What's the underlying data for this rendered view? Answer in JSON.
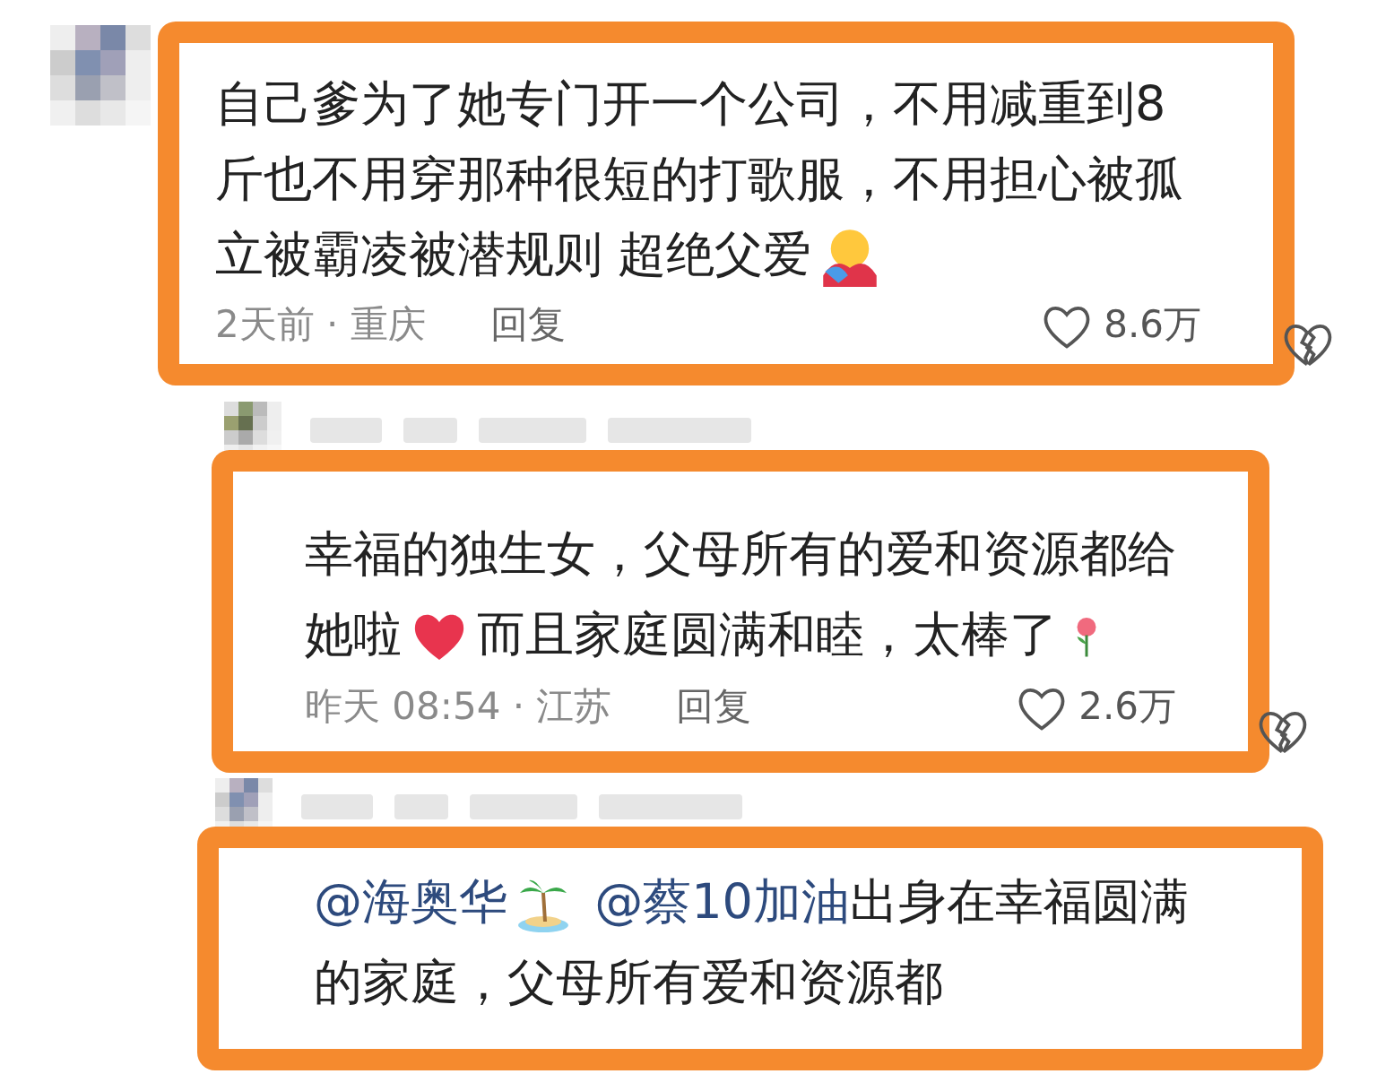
{
  "comments": [
    {
      "lines": [
        [
          {
            "kind": "text",
            "text": "自己爹为了她专门开一个公司，不用减重到8"
          }
        ],
        [
          {
            "kind": "text",
            "text": "斤也不用穿那种很短的打歌服，不用担心被孤"
          }
        ],
        [
          {
            "kind": "text",
            "text": "立被霸凌被潜规则 超绝父爱"
          },
          {
            "kind": "hug"
          }
        ]
      ],
      "time": "2天前 · 重庆",
      "reply": "回复",
      "likes": "8.6万"
    },
    {
      "lines": [
        [
          {
            "kind": "text",
            "text": "幸福的独生女，父母所有的爱和资源都给"
          }
        ],
        [
          {
            "kind": "text",
            "text": "她啦"
          },
          {
            "kind": "heart"
          },
          {
            "kind": "text",
            "text": "而且家庭圆满和睦，太棒了"
          },
          {
            "kind": "rose"
          }
        ]
      ],
      "time": "昨天 08:54 · 江苏",
      "reply": "回复",
      "likes": "2.6万"
    },
    {
      "lines": [
        [
          {
            "kind": "mention",
            "text": "@海奥华"
          },
          {
            "kind": "palm"
          },
          {
            "kind": "mention",
            "text": " @蔡10加油"
          },
          {
            "kind": "text",
            "text": " 出身在幸福圆满"
          }
        ],
        [
          {
            "kind": "text",
            "text": "的家庭，父母所有爱和资源都"
          }
        ]
      ]
    }
  ]
}
